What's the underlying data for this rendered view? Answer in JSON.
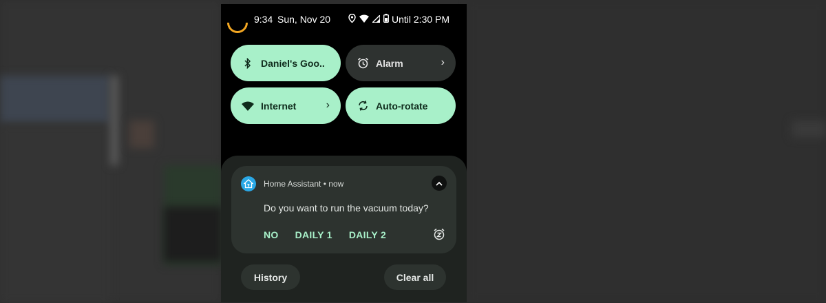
{
  "status_bar": {
    "time": "9:34",
    "date": "Sun, Nov 20",
    "battery_text": "Until 2:30 PM",
    "icons": [
      "location-icon",
      "wifi-icon",
      "signal-icon",
      "battery-icon"
    ],
    "loader_color": "#f4a722"
  },
  "quick_settings": [
    {
      "label": "Daniel's Goo..",
      "icon": "bluetooth-icon",
      "state": "on",
      "chevron": false
    },
    {
      "label": "Alarm",
      "icon": "alarm-icon",
      "state": "off",
      "chevron": true
    },
    {
      "label": "Internet",
      "icon": "wifi-icon",
      "state": "on",
      "chevron": true
    },
    {
      "label": "Auto-rotate",
      "icon": "auto-rotate-icon",
      "state": "on",
      "chevron": false
    }
  ],
  "notification": {
    "app_name": "Home Assistant",
    "separator": "•",
    "time": "now",
    "message": "Do you want to run the vacuum today?",
    "actions": [
      "NO",
      "DAILY 1",
      "DAILY 2"
    ],
    "app_icon_color": "#2aa8e6"
  },
  "buttons": {
    "history": "History",
    "clear_all": "Clear all"
  },
  "colors": {
    "tile_on": "#a8f0c9",
    "tile_off": "#2e3230",
    "accent_text": "#a8f0c9"
  }
}
